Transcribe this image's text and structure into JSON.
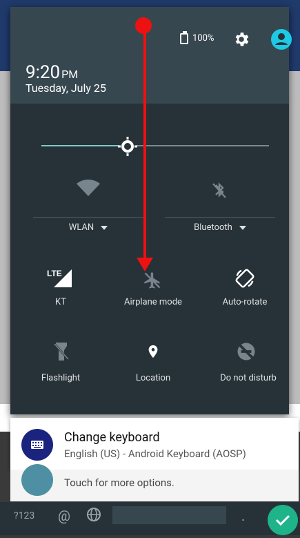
{
  "status": {
    "battery": "100%"
  },
  "header": {
    "time": "9:20",
    "time_suffix": "PM",
    "date": "Tuesday, July 25"
  },
  "quick_settings": {
    "wifi_label": "WLAN",
    "bluetooth_label": "Bluetooth",
    "tiles_row1": [
      {
        "label": "KT",
        "icon": "lte-signal-icon"
      },
      {
        "label": "Airplane mode",
        "icon": "airplane-icon"
      },
      {
        "label": "Auto-rotate",
        "icon": "auto-rotate-icon"
      }
    ],
    "tiles_row2": [
      {
        "label": "Flashlight",
        "icon": "flashlight-icon"
      },
      {
        "label": "Location",
        "icon": "location-icon"
      },
      {
        "label": "Do not disturb",
        "icon": "do-not-disturb-icon"
      }
    ]
  },
  "notifications": [
    {
      "title": "Change keyboard",
      "subtitle": "English (US) - Android Keyboard (AOSP)",
      "icon": "keyboard-icon"
    },
    {
      "subtitle": "Touch for more options.",
      "icon": "android-icon"
    }
  ],
  "keyboard": {
    "symbols_key": "?123",
    "at_key": "@",
    "period_key": "."
  },
  "colors": {
    "accent": "#1ec9e6",
    "arrow": "#ee1111",
    "shade": "#263238"
  }
}
